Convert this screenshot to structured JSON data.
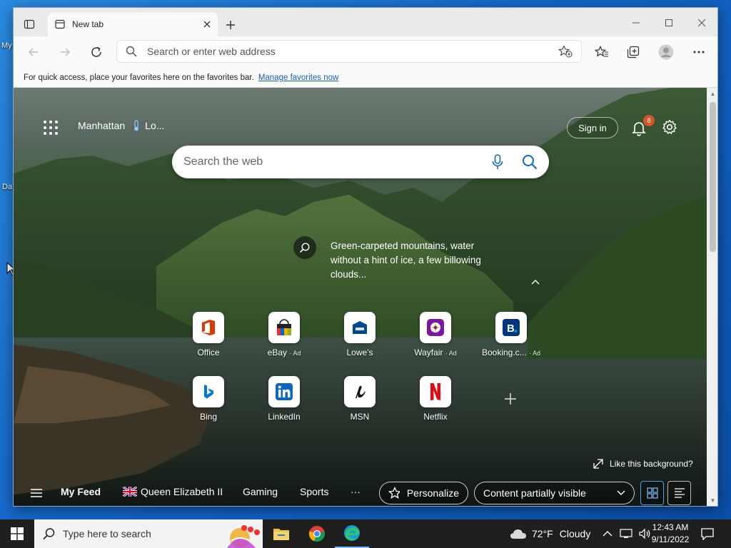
{
  "desktop": {
    "icon_labels": [
      "My",
      "Da"
    ]
  },
  "browser": {
    "tab": {
      "title": "New tab"
    },
    "address": {
      "placeholder": "Search or enter web address"
    },
    "favorites_bar": {
      "text": "For quick access, place your favorites here on the favorites bar.",
      "link": "Manage favorites now"
    }
  },
  "newtab": {
    "location": "Manhattan",
    "weather_short": "Lo...",
    "signin_label": "Sign in",
    "notification_count": "8",
    "search": {
      "placeholder": "Search the web"
    },
    "image_caption": "Green-carpeted mountains, water without a hint of ice, a few billowing clouds...",
    "tiles": [
      {
        "label": "Office",
        "ad": "",
        "icon": "office-icon",
        "color": "#d83b01"
      },
      {
        "label": "eBay",
        "ad": "· Ad",
        "icon": "ebay-icon",
        "color": "#e53238"
      },
      {
        "label": "Lowe's",
        "ad": "",
        "icon": "lowes-icon",
        "color": "#004990"
      },
      {
        "label": "Wayfair",
        "ad": "· Ad",
        "icon": "wayfair-icon",
        "color": "#7b189f"
      },
      {
        "label": "Booking.c...",
        "ad": "· Ad",
        "icon": "booking-icon",
        "color": "#003580"
      },
      {
        "label": "Bing",
        "ad": "",
        "icon": "bing-icon",
        "color": "#0078d4"
      },
      {
        "label": "LinkedIn",
        "ad": "",
        "icon": "linkedin-icon",
        "color": "#0a66c2"
      },
      {
        "label": "MSN",
        "ad": "",
        "icon": "msn-icon",
        "color": "#111111"
      },
      {
        "label": "Netflix",
        "ad": "",
        "icon": "netflix-icon",
        "color": "#e50914"
      }
    ],
    "like_background": "Like this background?",
    "feed": {
      "items": [
        "My Feed",
        "Queen Elizabeth II",
        "Gaming",
        "Sports"
      ],
      "more": "···",
      "personalize_label": "Personalize",
      "content_visibility": "Content partially visible"
    }
  },
  "taskbar": {
    "search_placeholder": "Type here to search",
    "weather": {
      "temp": "72°F",
      "condition": "Cloudy"
    },
    "time": "12:43 AM",
    "date": "9/11/2022"
  }
}
